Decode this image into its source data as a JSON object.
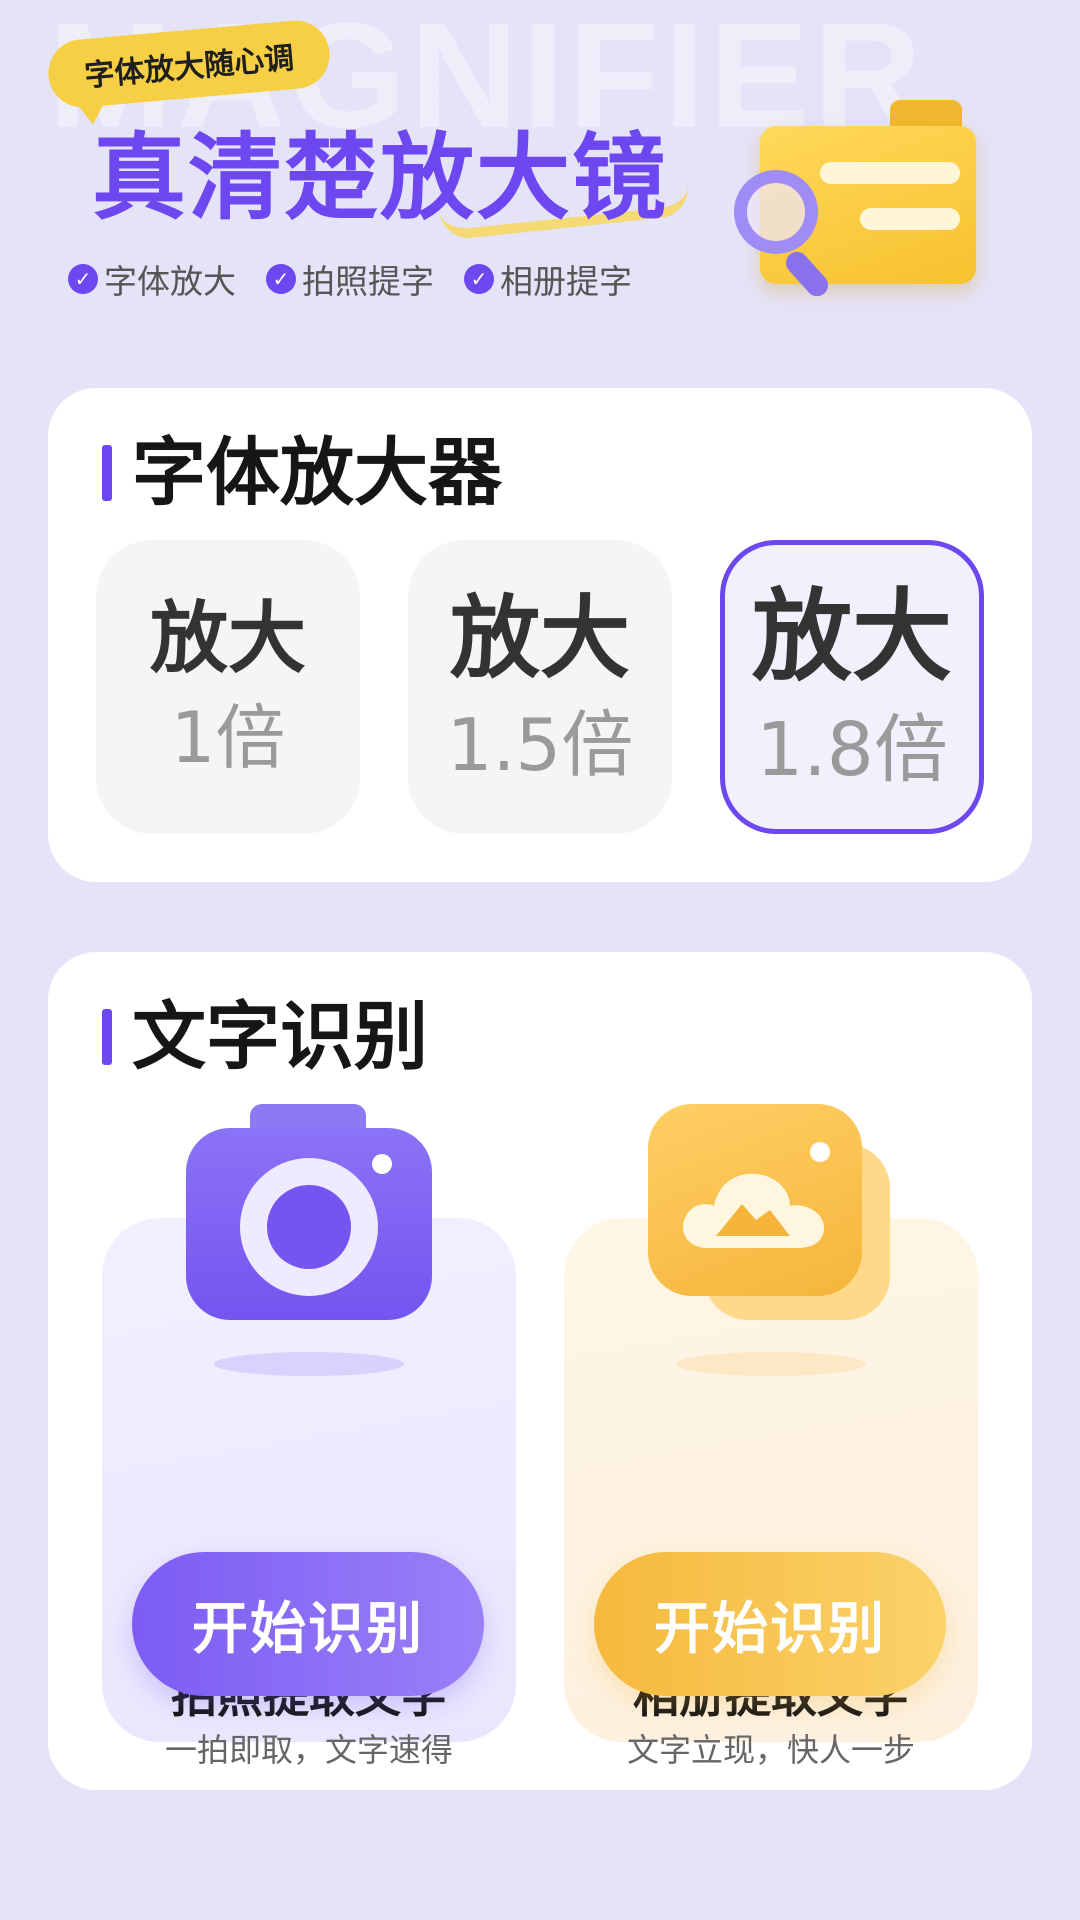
{
  "header": {
    "background_word": "MAGNIFIER",
    "tag_bubble": "字体放大随心调",
    "headline": "真清楚放大镜",
    "features": [
      "字体放大",
      "拍照提字",
      "相册提字"
    ],
    "check_icon": "checkmark-circle-icon",
    "illustration": "folder-magnifier-icon"
  },
  "zoom_card": {
    "title": "字体放大器",
    "options": [
      {
        "label": "放大",
        "multiplier": "1倍",
        "selected": false
      },
      {
        "label": "放大",
        "multiplier": "1.5倍",
        "selected": false
      },
      {
        "label": "放大",
        "multiplier": "1.8倍",
        "selected": true
      }
    ]
  },
  "ocr_card": {
    "title": "文字识别",
    "photo": {
      "icon": "camera-icon",
      "title": "拍照提取文字",
      "subtitle": "一拍即取，文字速得",
      "button": "开始识别"
    },
    "album": {
      "icon": "photo-album-icon",
      "title": "相册提取文字",
      "subtitle": "文字立现，快人一步",
      "button": "开始识别"
    }
  },
  "colors": {
    "background": "#e5e3f8",
    "accent_purple": "#6d48f0",
    "accent_yellow": "#f7cf45",
    "card": "#ffffff"
  }
}
